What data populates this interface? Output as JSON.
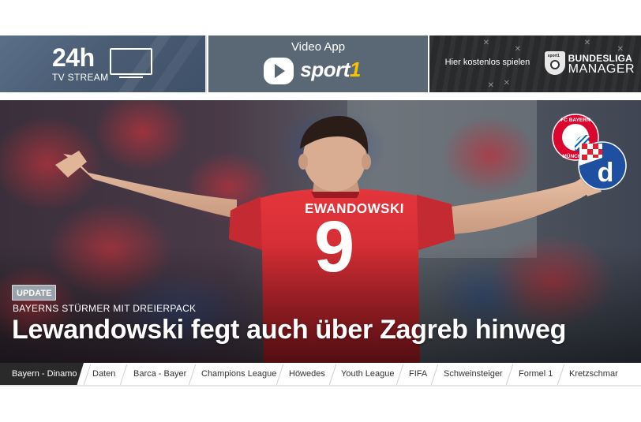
{
  "banners": {
    "stream": {
      "big": "24h",
      "small": "TV STREAM"
    },
    "video": {
      "title": "Video App",
      "brand_main": "sport",
      "brand_accent": "1"
    },
    "manager": {
      "cta": "Hier kostenlos spielen",
      "line1": "BUNDESLIGA",
      "line2": "MANAGER",
      "shield_text": "sport1"
    }
  },
  "hero": {
    "badge": "UPDATE",
    "kicker": "BAYERNS STÜRMER MIT DREIERPACK",
    "headline": "Lewandowski fegt auch über Zagreb hinweg",
    "jersey_name": "EWANDOWSKI",
    "jersey_number": "9",
    "club_home": "FC BAYERN MÜNCHEN",
    "club_away_letter": "d"
  },
  "tags": [
    {
      "label": "Bayern - Dinamo",
      "active": true
    },
    {
      "label": "Daten"
    },
    {
      "label": "Barca - Bayer"
    },
    {
      "label": "Champions League"
    },
    {
      "label": "Höwedes"
    },
    {
      "label": "Youth League"
    },
    {
      "label": "FIFA"
    },
    {
      "label": "Schweinsteiger"
    },
    {
      "label": "Formel 1"
    },
    {
      "label": "Kretzschmar"
    }
  ],
  "colors": {
    "accent_yellow": "#f5c400",
    "jersey_red": "#d8262e",
    "bayern_red": "#dc052d",
    "bayern_blue": "#0066b2",
    "dinamo_blue": "#1e4fa0"
  }
}
